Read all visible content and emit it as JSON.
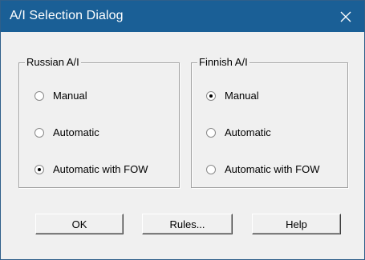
{
  "window": {
    "title": "A/I Selection Dialog",
    "close_glyph": "✕",
    "titlebar_color": "#1a5f96"
  },
  "russian_group": {
    "legend": "Russian A/I",
    "options": [
      {
        "label": "Manual",
        "checked": false
      },
      {
        "label": "Automatic",
        "checked": false
      },
      {
        "label": "Automatic with FOW",
        "checked": true
      }
    ]
  },
  "finnish_group": {
    "legend": "Finnish A/I",
    "options": [
      {
        "label": "Manual",
        "checked": true
      },
      {
        "label": "Automatic",
        "checked": false
      },
      {
        "label": "Automatic with FOW",
        "checked": false
      }
    ]
  },
  "buttons": {
    "ok": "OK",
    "rules": "Rules...",
    "help": "Help"
  }
}
